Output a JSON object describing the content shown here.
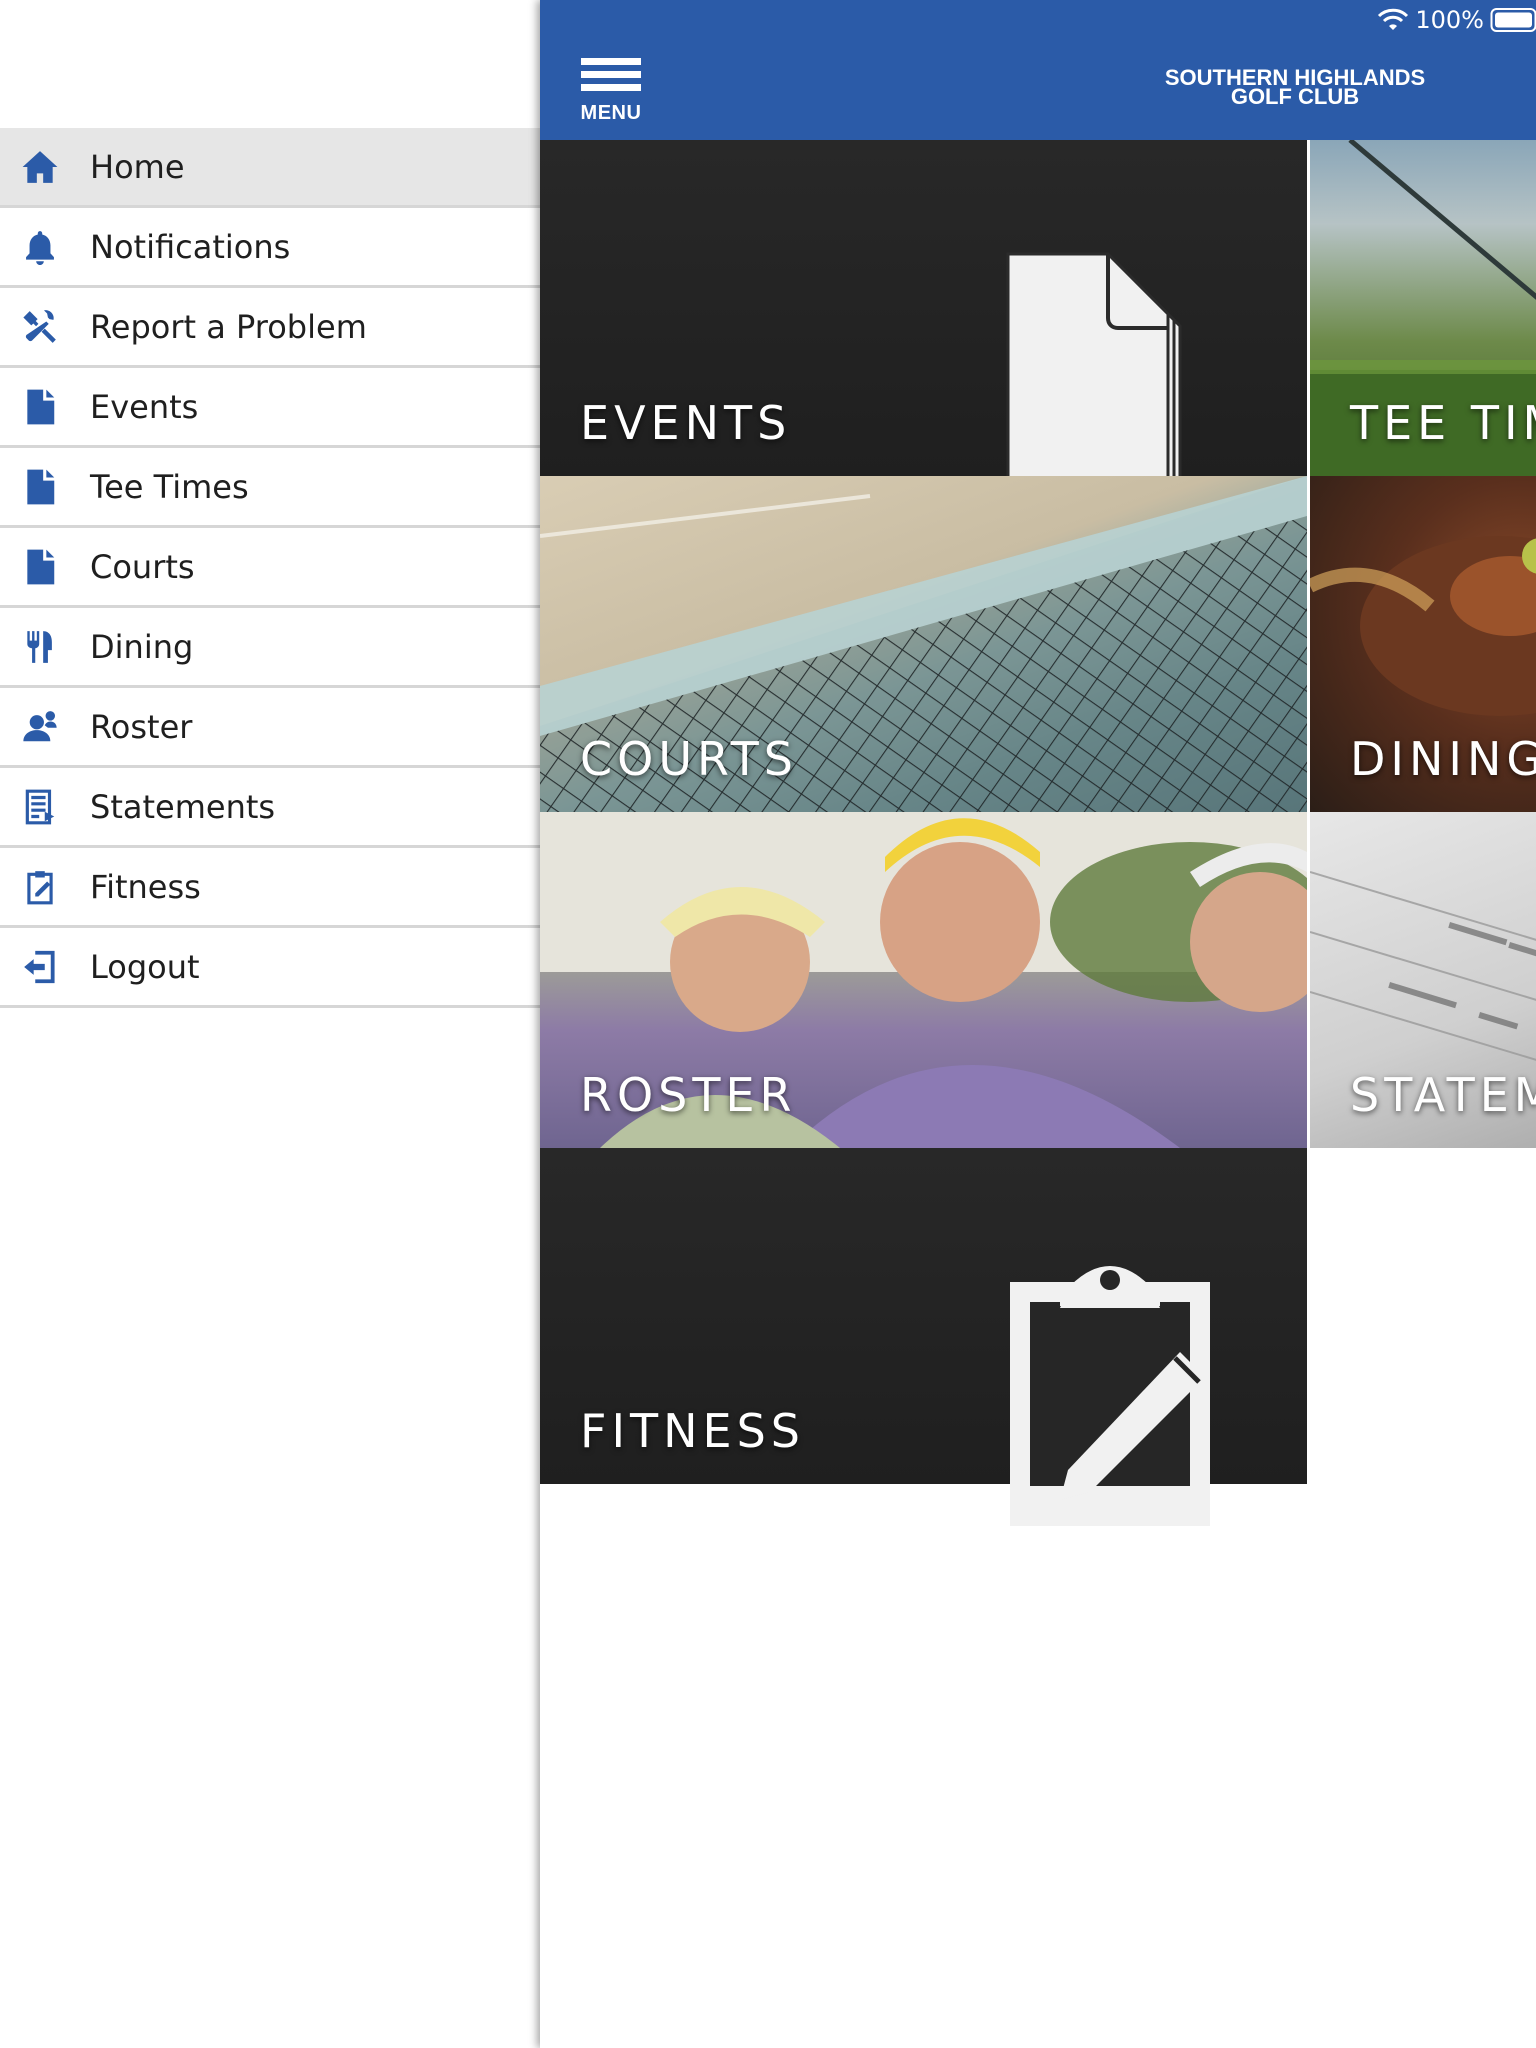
{
  "status_bar": {
    "battery": "100%"
  },
  "header": {
    "menu_label": "MENU",
    "club_name_line1": "SOUTHERN HIGHLANDS",
    "club_name_line2": "GOLF CLUB"
  },
  "sidebar": {
    "items": [
      {
        "label": "Home",
        "icon": "home-icon",
        "active": true
      },
      {
        "label": "Notifications",
        "icon": "bell-icon"
      },
      {
        "label": "Report a Problem",
        "icon": "tools-icon"
      },
      {
        "label": "Events",
        "icon": "document-icon"
      },
      {
        "label": "Tee Times",
        "icon": "document-icon"
      },
      {
        "label": "Courts",
        "icon": "document-icon"
      },
      {
        "label": "Dining",
        "icon": "utensils-icon"
      },
      {
        "label": "Roster",
        "icon": "user-icon"
      },
      {
        "label": "Statements",
        "icon": "statement-icon"
      },
      {
        "label": "Fitness",
        "icon": "clipboard-edit-icon"
      },
      {
        "label": "Logout",
        "icon": "logout-icon"
      }
    ]
  },
  "tiles": {
    "events": "EVENTS",
    "tee_times": "TEE TIM",
    "courts": "COURTS",
    "dining": "DINING",
    "roster": "ROSTER",
    "statements": "STATEM",
    "fitness": "FITNESS"
  },
  "colors": {
    "header_bg": "#2b5ba8",
    "icon_blue": "#2b5ba8",
    "active_row": "#e6e6e6",
    "tile_dark": "#262626"
  }
}
